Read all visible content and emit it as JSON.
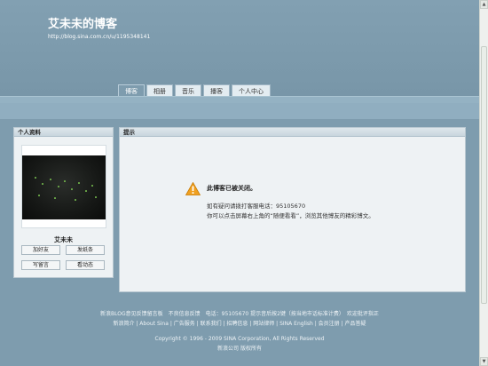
{
  "header": {
    "blog_title": "艾未未的博客",
    "blog_url": "http://blog.sina.com.cn/u/1195348141"
  },
  "tabs": [
    {
      "label": "博客",
      "active": true
    },
    {
      "label": "相册",
      "active": false
    },
    {
      "label": "音乐",
      "active": false
    },
    {
      "label": "播客",
      "active": false
    },
    {
      "label": "个人中心",
      "active": false
    }
  ],
  "profile": {
    "heading": "个人资料",
    "username": "艾未未",
    "buttons": {
      "add_friend": "加好友",
      "send_note": "发纸条",
      "write_message": "写留言",
      "view_activity": "看动态"
    }
  },
  "notice": {
    "heading": "提示",
    "icon": "warning-icon",
    "title": "此博客已被关闭。",
    "line1": "如有疑问请拨打客服电话：95105670",
    "line2": "你可以点击屏幕右上角的“随便看看”，浏览其他博友的精彩博文。"
  },
  "footer": {
    "line1": "新浪BLOG意见反馈留言板　不良信息反馈　电话：95105670 提示音后按2键（按当地市话标准计费）　欢迎批评指正",
    "line2": "新浪简介 | About Sina | 广告服务 | 联系我们 | 招聘信息 | 网站律师 | SINA English | 会员注册 | 产品答疑",
    "copyright": "Copyright © 1996 - 2009 SINA Corporation, All Rights Reserved",
    "line4": "新浪公司 版权所有"
  },
  "colors": {
    "background": "#7e9cae",
    "panel": "#eef2f4",
    "warning": "#f0a020"
  }
}
